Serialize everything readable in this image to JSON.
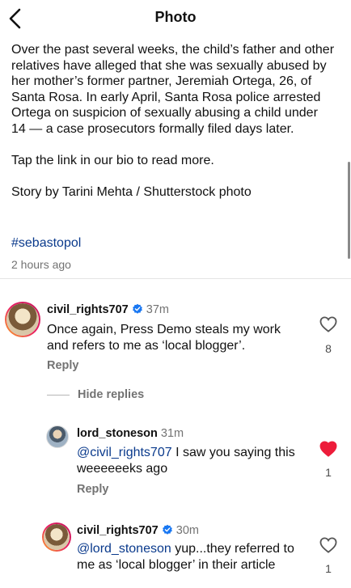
{
  "header": {
    "title": "Photo"
  },
  "caption": {
    "paragraph1": "Over the past several weeks, the child’s father and other relatives have alleged that she was sexually abused by her mother’s former partner, Jeremiah Ortega, 26, of Santa Rosa. In early April, Santa Rosa police arrested Ortega on suspicion of sexually abusing a child under 14 — a case prosecutors formally filed days later.",
    "paragraph2": "Tap the link in our bio to read more.",
    "paragraph3": "Story by Tarini Mehta / Shutterstock photo",
    "hashtag": "#sebastopol",
    "time_ago": "2 hours ago"
  },
  "comments": [
    {
      "username": "civil_rights707",
      "verified": true,
      "time": "37m",
      "text": "Once again, Press Demo steals my work and refers to me as ‘local blogger’.",
      "likes": "8",
      "liked": false,
      "reply_label": "Reply",
      "hide_replies_label": "Hide replies",
      "replies": [
        {
          "username": "lord_stoneson",
          "verified": false,
          "time": "31m",
          "mention": "@civil_rights707",
          "text": " I saw you saying this weeeeeeks ago",
          "likes": "1",
          "liked": true,
          "reply_label": "Reply"
        },
        {
          "username": "civil_rights707",
          "verified": true,
          "time": "30m",
          "mention": "@lord_stoneson",
          "text": " yup...they referred to me as ‘local blogger’ in their article",
          "likes": "1",
          "liked": false
        }
      ]
    }
  ],
  "colors": {
    "verified": "#1877f2",
    "liked_heart": "#ed1c3a",
    "mention": "#0a3a8c"
  },
  "icons": {
    "back": "chevron-left-icon",
    "like": "heart-icon",
    "verified": "verified-badge-icon"
  }
}
